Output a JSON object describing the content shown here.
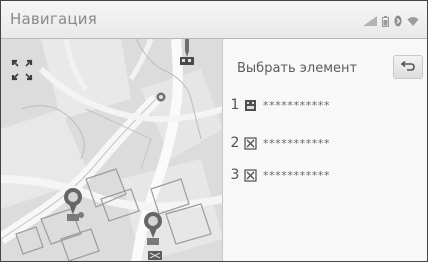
{
  "header": {
    "title": "Навигация"
  },
  "status_bar": {
    "icons": [
      "signal-icon",
      "battery-icon",
      "bluetooth-icon",
      "wifi-icon"
    ]
  },
  "map": {
    "expand_icon": "expand-icon",
    "pins": [
      "map-pin-icon",
      "map-pin-icon",
      "map-pin-icon",
      "map-pin-icon"
    ]
  },
  "panel": {
    "header_label": "Выбрать элемент",
    "back_icon": "back-arrow-icon",
    "items": [
      {
        "number": "1",
        "icon": "building-icon",
        "label": "***********"
      },
      {
        "number": "2",
        "icon": "location-flag-icon",
        "label": "***********"
      },
      {
        "number": "3",
        "icon": "location-flag-icon",
        "label": "***********"
      }
    ]
  },
  "colors": {
    "title_bar": "#efefef",
    "map_bg": "#e5e5e5",
    "panel_bg": "#f8f8f8",
    "text_gray": "#5c5c5c"
  }
}
